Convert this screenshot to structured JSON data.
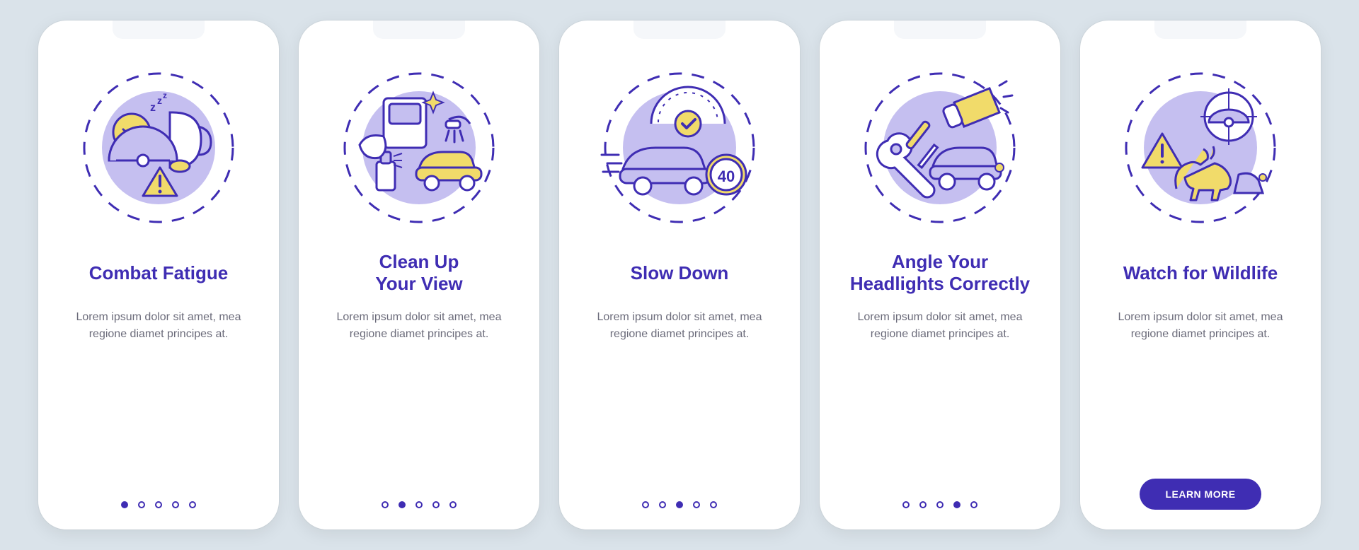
{
  "screens": [
    {
      "id": "combat-fatigue",
      "title": "Combat Fatigue",
      "body": "Lorem ipsum dolor sit amet, mea regione diamet principes at.",
      "active_dot": 0,
      "cta": null,
      "icon": "fatigue"
    },
    {
      "id": "clean-up-view",
      "title": "Clean Up\nYour View",
      "body": "Lorem ipsum dolor sit amet, mea regione diamet principes at.",
      "active_dot": 1,
      "cta": null,
      "icon": "clean"
    },
    {
      "id": "slow-down",
      "title": "Slow Down",
      "body": "Lorem ipsum dolor sit amet, mea regione diamet principes at.",
      "active_dot": 2,
      "cta": null,
      "icon": "slow"
    },
    {
      "id": "angle-headlights",
      "title": "Angle Your\nHeadlights Correctly",
      "body": "Lorem ipsum dolor sit amet, mea regione diamet principes at.",
      "active_dot": 3,
      "cta": null,
      "icon": "headlights"
    },
    {
      "id": "watch-wildlife",
      "title": "Watch for Wildlife",
      "body": "Lorem ipsum dolor sit amet, mea regione diamet principes at.",
      "active_dot": 4,
      "cta": "LEARN MORE",
      "icon": "wildlife"
    }
  ],
  "total_dots": 5,
  "colors": {
    "primary": "#3f2db3",
    "accent_yellow": "#f1db6a",
    "accent_purple": "#c5bff0",
    "bg": "#dae3ea"
  }
}
